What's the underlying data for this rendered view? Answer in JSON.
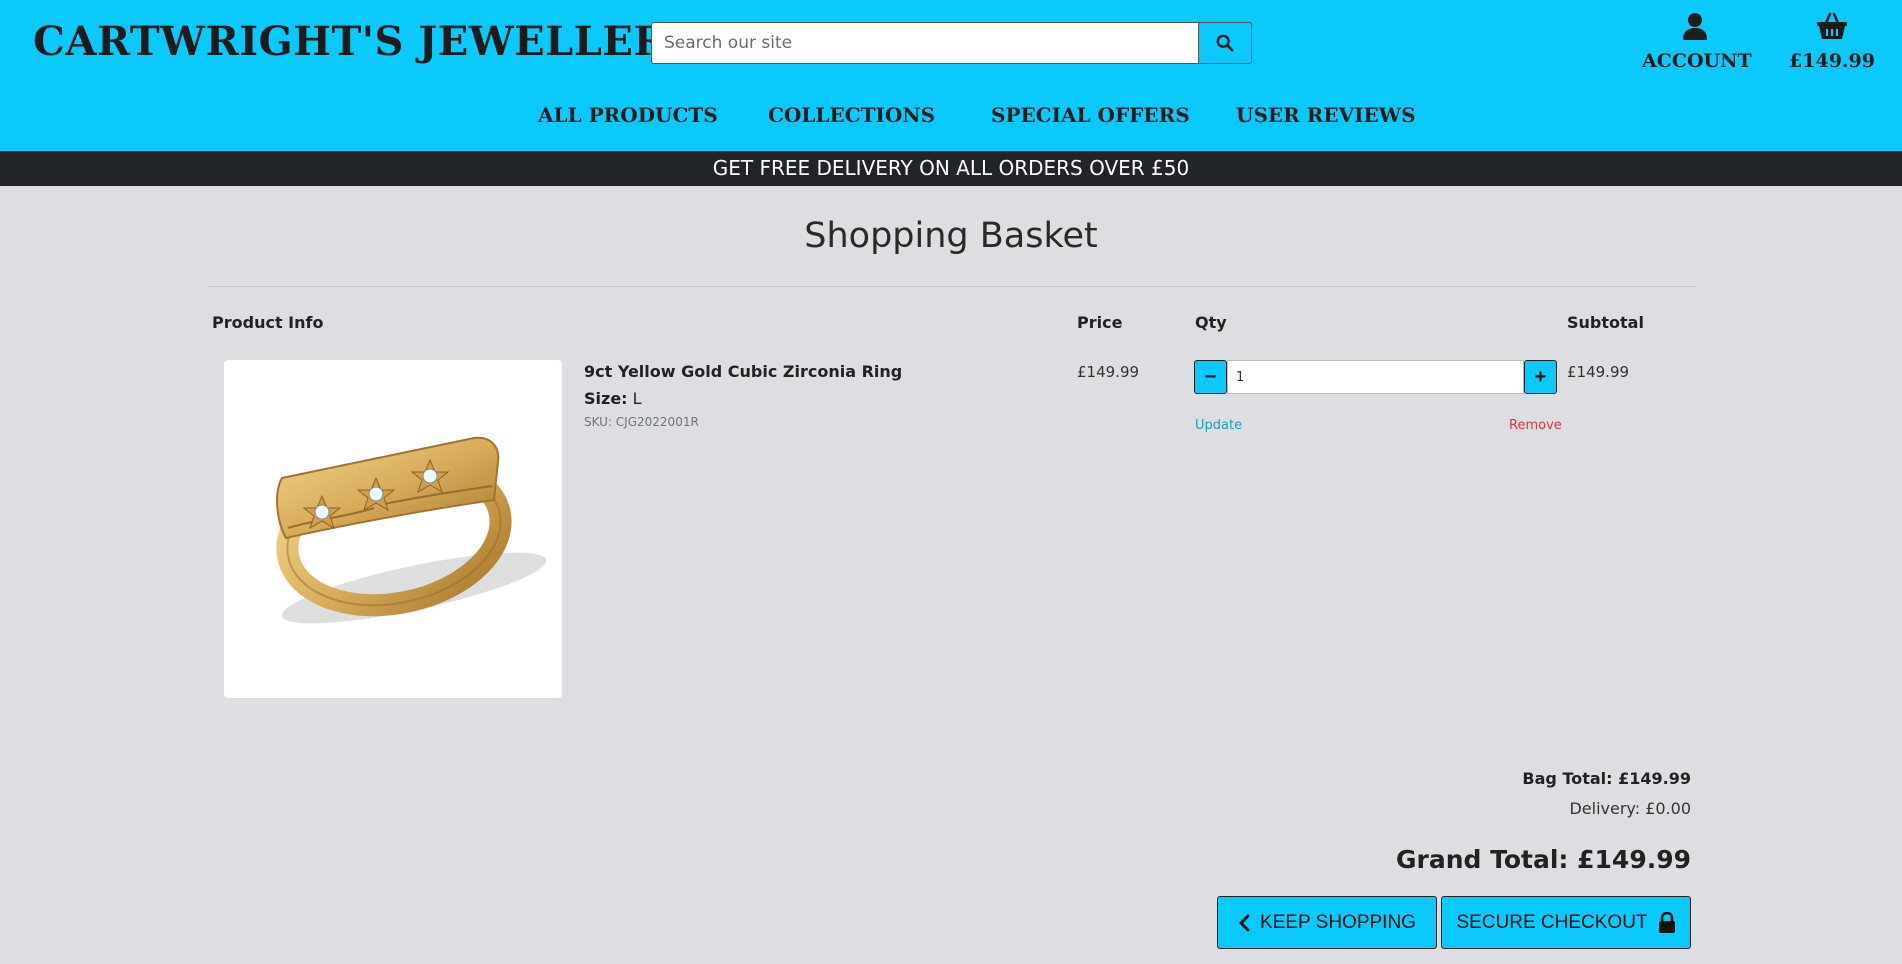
{
  "header": {
    "logo": "CARTWRIGHT'S JEWELLERY",
    "search_placeholder": "Search our site",
    "account_label": "ACCOUNT",
    "basket_total": "£149.99",
    "brand_color": "#0cc9fb"
  },
  "nav": {
    "items": [
      "ALL PRODUCTS",
      "COLLECTIONS",
      "SPECIAL OFFERS",
      "USER REVIEWS"
    ]
  },
  "promo": "GET FREE DELIVERY ON ALL ORDERS OVER £50",
  "page_title": "Shopping Basket",
  "columns": {
    "product_info": "Product Info",
    "price": "Price",
    "qty": "Qty",
    "subtotal": "Subtotal"
  },
  "item": {
    "name": "9ct Yellow Gold Cubic Zirconia Ring",
    "size_label": "Size:",
    "size_value": "L",
    "sku": "SKU: CJG2022001R",
    "price": "£149.99",
    "quantity": "1",
    "decrement": "−",
    "increment": "+",
    "update_label": "Update",
    "remove_label": "Remove",
    "subtotal": "£149.99"
  },
  "totals": {
    "bag_total": "Bag Total: £149.99",
    "delivery": "Delivery: £0.00",
    "grand_total": "Grand Total: £149.99"
  },
  "actions": {
    "keep_shopping": "KEEP SHOPPING",
    "secure_checkout": "SECURE CHECKOUT"
  },
  "icons": {
    "search": "search-icon",
    "account": "user-icon",
    "basket": "shopping-basket-icon",
    "back": "chevron-left-icon",
    "lock": "lock-icon"
  }
}
